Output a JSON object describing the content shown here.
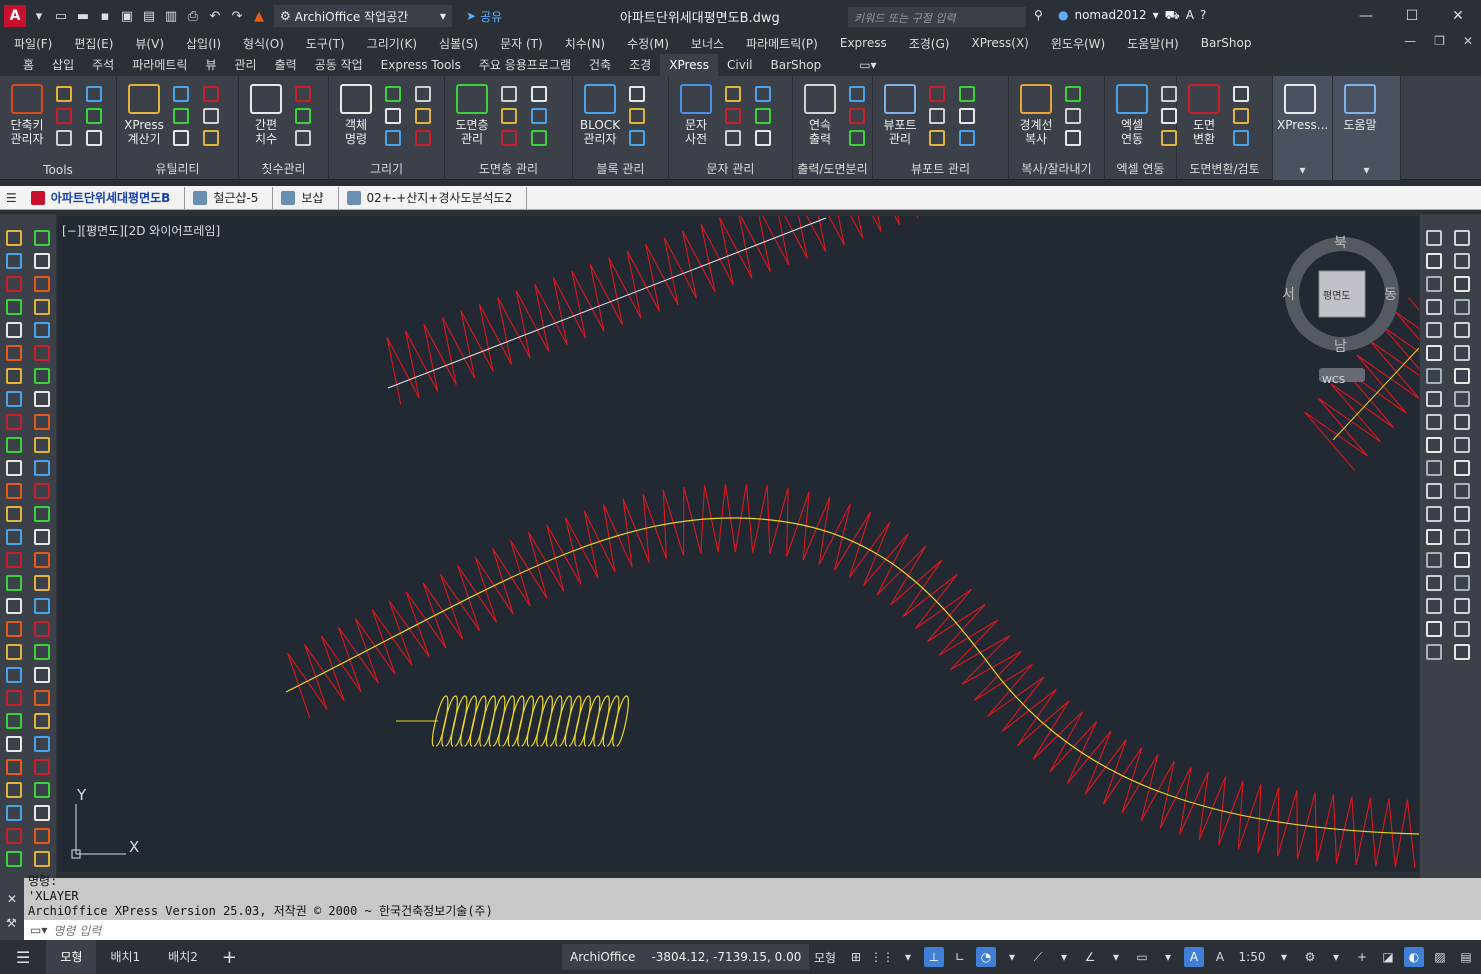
{
  "titlebar": {
    "app_logo": "A",
    "workspace": "ArchiOffice 작업공간",
    "share": "공유",
    "doc_title": "아파트단위세대평면도B.dwg",
    "search_placeholder": "키워드 또는 구절 입력",
    "user": "nomad2012"
  },
  "menu": [
    "파일(F)",
    "편집(E)",
    "뷰(V)",
    "삽입(I)",
    "형식(O)",
    "도구(T)",
    "그리기(K)",
    "심볼(S)",
    "문자 (T)",
    "치수(N)",
    "수정(M)",
    "보너스",
    "파라메트릭(P)",
    "Express",
    "조경(G)",
    "XPress(X)",
    "윈도우(W)",
    "도움말(H)",
    "BarShop"
  ],
  "ribbon_tabs": [
    "홈",
    "삽입",
    "주석",
    "파라메트릭",
    "뷰",
    "관리",
    "출력",
    "공동 작업",
    "Express Tools",
    "주요 응용프로그램",
    "건축",
    "조경",
    "XPress",
    "Civil",
    "BarShop"
  ],
  "active_tab": "XPress",
  "panels": [
    {
      "label": "Tools",
      "big": "단축키\n관리자"
    },
    {
      "label": "유틸리티",
      "big": "XPress\n계산기"
    },
    {
      "label": "칫수관리",
      "big": "간편\n치수"
    },
    {
      "label": "그리기",
      "big": "객체\n명령"
    },
    {
      "label": "도면층 관리",
      "big": "도면층\n관리"
    },
    {
      "label": "블록 관리",
      "big": "BLOCK\n관리자"
    },
    {
      "label": "문자 관리",
      "big": "문자\n사전"
    },
    {
      "label": "출력/도면분리",
      "big": "연속\n출력"
    },
    {
      "label": "뷰포트 관리",
      "big": "뷰포트\n관리"
    },
    {
      "label": "복사/잘라내기",
      "big": "경계선\n복사"
    },
    {
      "label": "엑셀 연동",
      "big": "엑셀\n연동"
    },
    {
      "label": "도면변환/검토",
      "big": "도면\n변환"
    },
    {
      "label": "",
      "big": "XPress..."
    },
    {
      "label": "",
      "big": "도움말"
    }
  ],
  "file_tabs": [
    "아파트단위세대평면도B",
    "철근샵-5",
    "보샵",
    "02+-+산지+경사도분석도2"
  ],
  "viewport": {
    "label": "[−][평면도][2D 와이어프레임]",
    "viewcube": {
      "top": "북",
      "bottom": "남",
      "left": "서",
      "right": "동",
      "face": "평면도",
      "wcs": "WCS"
    },
    "ucs": {
      "x": "X",
      "y": "Y"
    }
  },
  "command": {
    "history": [
      "명령:",
      "'XLAYER",
      "ArchiOffice XPress Version 25.03, 저작권 © 2000 ~ 한국건축정보기술(주)"
    ],
    "placeholder": "명령 입력"
  },
  "status": {
    "layout_tabs": [
      "모형",
      "배치1",
      "배치2"
    ],
    "app": "ArchiOffice",
    "coords": "-3804.12, -7139.15, 0.00",
    "space": "모형",
    "scale": "1:50"
  },
  "colors": {
    "insulation": "#e0161b",
    "centerline_yellow": "#e8d51e",
    "centerline_white": "#e8e8e8",
    "canvas": "#222933"
  }
}
